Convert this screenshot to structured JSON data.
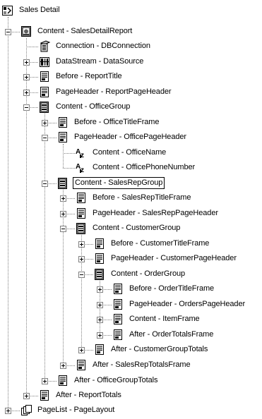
{
  "tree": [
    {
      "label": "Sales Detail",
      "icon": "report-icon",
      "depth": 0,
      "toggle": "none"
    },
    {
      "label": "Content - SalesDetailReport",
      "icon": "report-content-icon",
      "depth": 1,
      "toggle": "minus"
    },
    {
      "label": "Connection - DBConnection",
      "icon": "db-connection-icon",
      "depth": 2,
      "toggle": "none"
    },
    {
      "label": "DataStream - DataSource",
      "icon": "data-stream-icon",
      "depth": 2,
      "toggle": "plus"
    },
    {
      "label": "Before - ReportTitle",
      "icon": "frame-icon",
      "depth": 2,
      "toggle": "plus"
    },
    {
      "label": "PageHeader - ReportPageHeader",
      "icon": "frame-icon",
      "depth": 2,
      "toggle": "plus"
    },
    {
      "label": "Content - OfficeGroup",
      "icon": "group-icon",
      "depth": 2,
      "toggle": "minus"
    },
    {
      "label": "Before - OfficeTitleFrame",
      "icon": "frame-icon",
      "depth": 3,
      "toggle": "plus"
    },
    {
      "label": "PageHeader - OfficePageHeader",
      "icon": "frame-icon",
      "depth": 3,
      "toggle": "minus"
    },
    {
      "label": "Content - OfficeName",
      "icon": "text-field-icon",
      "depth": 4,
      "toggle": "none"
    },
    {
      "label": "Content - OfficePhoneNumber",
      "icon": "text-field-icon",
      "depth": 4,
      "toggle": "none"
    },
    {
      "label": "Content - SalesRepGroup",
      "icon": "group-icon",
      "depth": 3,
      "toggle": "minus",
      "selected": true
    },
    {
      "label": "Before - SalesRepTitleFrame",
      "icon": "frame-icon",
      "depth": 4,
      "toggle": "plus"
    },
    {
      "label": "PageHeader - SalesRepPageHeader",
      "icon": "frame-icon",
      "depth": 4,
      "toggle": "plus"
    },
    {
      "label": "Content - CustomerGroup",
      "icon": "group-icon",
      "depth": 4,
      "toggle": "minus"
    },
    {
      "label": "Before - CustomerTitleFrame",
      "icon": "frame-icon",
      "depth": 5,
      "toggle": "plus"
    },
    {
      "label": "PageHeader - CustomerPageHeader",
      "icon": "frame-icon",
      "depth": 5,
      "toggle": "plus"
    },
    {
      "label": "Content - OrderGroup",
      "icon": "group-icon",
      "depth": 5,
      "toggle": "minus"
    },
    {
      "label": "Before - OrderTitleFrame",
      "icon": "frame-icon",
      "depth": 6,
      "toggle": "plus"
    },
    {
      "label": "PageHeader - OrdersPageHeader",
      "icon": "frame-icon",
      "depth": 6,
      "toggle": "plus"
    },
    {
      "label": "Content - ItemFrame",
      "icon": "frame-icon",
      "depth": 6,
      "toggle": "plus"
    },
    {
      "label": "After - OrderTotalsFrame",
      "icon": "frame-icon",
      "depth": 6,
      "toggle": "plus"
    },
    {
      "label": "After - CustomerGroupTotals",
      "icon": "frame-icon",
      "depth": 5,
      "toggle": "plus"
    },
    {
      "label": "After - SalesRepTotalsFrame",
      "icon": "frame-icon",
      "depth": 4,
      "toggle": "plus"
    },
    {
      "label": "After - OfficeGroupTotals",
      "icon": "frame-icon",
      "depth": 3,
      "toggle": "plus"
    },
    {
      "label": "After - ReportTotals",
      "icon": "frame-icon",
      "depth": 2,
      "toggle": "plus"
    },
    {
      "label": "PageList - PageLayout",
      "icon": "page-list-icon",
      "depth": 1,
      "toggle": "plus"
    }
  ]
}
